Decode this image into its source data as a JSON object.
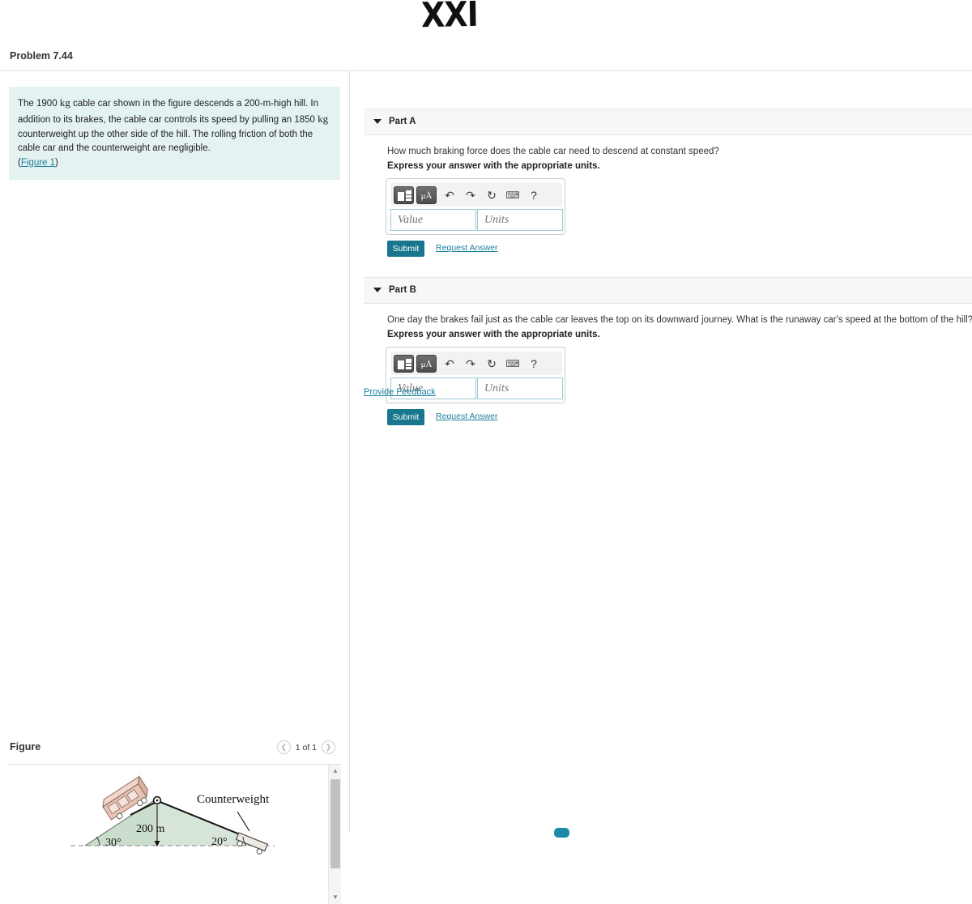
{
  "annotation": {
    "text": "XXI"
  },
  "header": {
    "problem_title": "Problem 7.44"
  },
  "statement": {
    "line1_a": "The 1900 ",
    "line1_kg": "kg",
    "line1_b": " cable car shown in the figure descends a 200-m-high hill. In addition to its brakes,",
    "line2_a": "the cable car controls its speed by pulling an 1850 ",
    "line2_kg": "kg",
    "line2_b": " counterweight up the other side of the hill.",
    "line3": "The rolling friction of both the cable car and the counterweight are negligible.",
    "figure_ref_open": "(",
    "figure_ref": "Figure 1",
    "figure_ref_close": ")"
  },
  "figure_panel": {
    "label": "Figure",
    "prev_icon": "chevron-left",
    "next_icon": "chevron-right",
    "counter": "1 of 1",
    "scroll_up_icon": "triangle-up",
    "scroll_down_icon": "triangle-down",
    "diagram": {
      "counterweight_label": "Counterweight",
      "height_label": "200 m",
      "left_angle": "30°",
      "right_angle": "20°",
      "hill_fill": "#cfdfd2",
      "car_fill": "#e8c3b4",
      "cable_color": "#1a1a1a"
    }
  },
  "parts": [
    {
      "id": "part-a",
      "chevron_icon": "triangle-down",
      "title": "Part A",
      "question": "How much braking force does the cable car need to descend at constant speed?",
      "instruction": "Express your answer with the appropriate units.",
      "toolbar": {
        "template_icon": "template-grid-icon",
        "units_label": "μÅ",
        "undo_icon": "↶",
        "redo_icon": "↷",
        "reset_icon": "↻",
        "keyboard_icon": "⌨",
        "help_icon": "?"
      },
      "value_placeholder": "Value",
      "units_placeholder": "Units",
      "value": "",
      "units": "",
      "submit_label": "Submit",
      "request_answer_label": "Request Answer"
    },
    {
      "id": "part-b",
      "chevron_icon": "triangle-down",
      "title": "Part B",
      "question": "One day the brakes fail just as the cable car leaves the top on its downward journey. What is the runaway car's speed at the bottom of the hill?",
      "instruction": "Express your answer with the appropriate units.",
      "toolbar": {
        "template_icon": "template-grid-icon",
        "units_label": "μÅ",
        "undo_icon": "↶",
        "redo_icon": "↷",
        "reset_icon": "↻",
        "keyboard_icon": "⌨",
        "help_icon": "?"
      },
      "value_placeholder": "Value",
      "units_placeholder": "Units",
      "value": "",
      "units": "",
      "submit_label": "Submit",
      "request_answer_label": "Request Answer"
    }
  ],
  "footer": {
    "provide_feedback_label": "Provide Feedback"
  },
  "colors": {
    "accent_teal": "#18768f",
    "link_teal": "#1a7f9e",
    "statement_bg": "#e4f2f1",
    "part_header_bg": "#f7f7f7"
  }
}
